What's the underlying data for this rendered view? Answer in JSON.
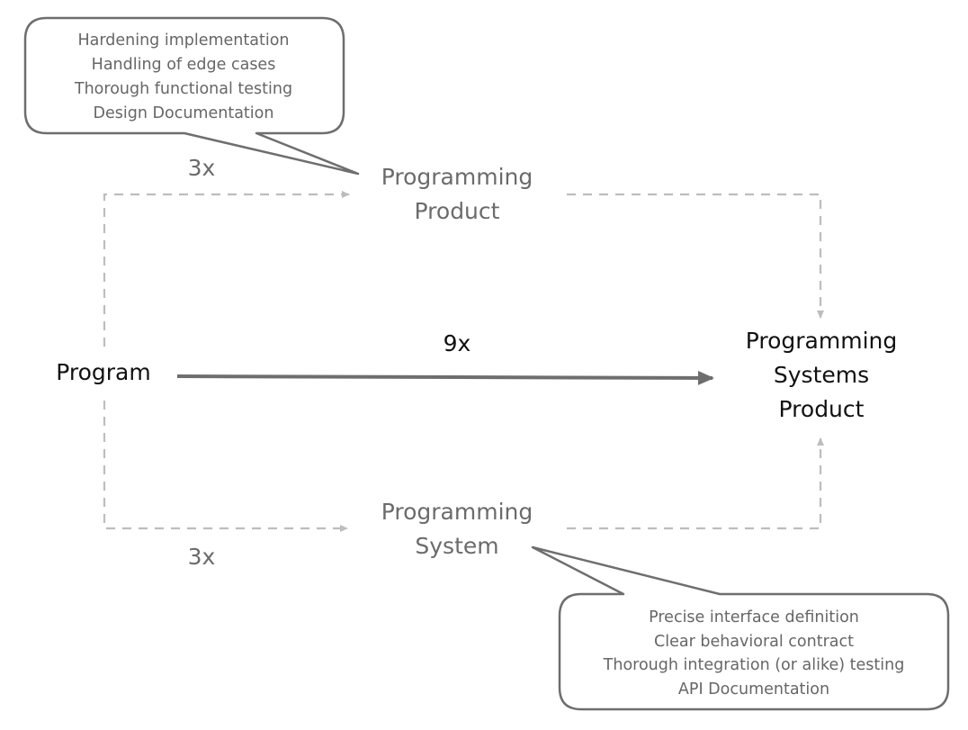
{
  "nodes": {
    "program": "Program",
    "product": [
      "Programming",
      "Product"
    ],
    "system": [
      "Programming",
      "System"
    ],
    "systems_product": [
      "Programming",
      "Systems",
      "Product"
    ]
  },
  "edges": {
    "to_product": "3x",
    "to_system": "3x",
    "direct": "9x"
  },
  "callouts": {
    "product": [
      "Hardening implementation",
      "Handling of edge cases",
      "Thorough functional testing",
      "Design Documentation"
    ],
    "system": [
      "Precise interface definition",
      "Clear behavioral contract",
      "Thorough integration (or alike) testing",
      "API Documentation"
    ]
  },
  "colors": {
    "dashed_edge": "#bdbdbd",
    "main_edge": "#6e6e6e",
    "secondary_text": "#6b6b6b"
  }
}
